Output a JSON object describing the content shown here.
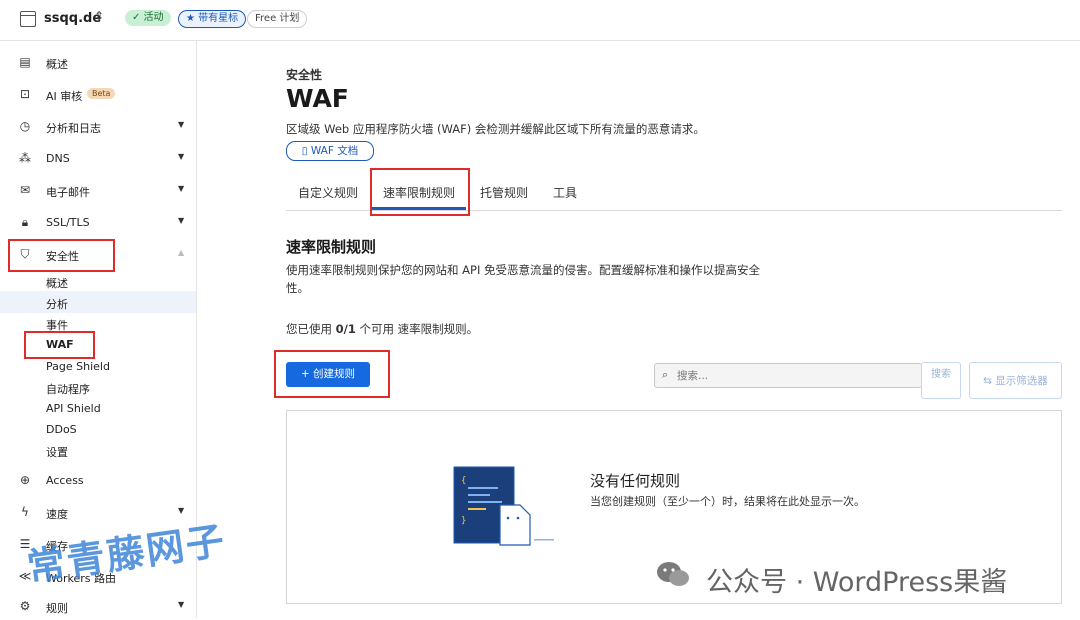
{
  "topbar": {
    "domain": "ssqq.de",
    "switch_icon": "chevron-up-down-icon",
    "badge_active": "✓ 活动",
    "badge_star": "★ 带有星标",
    "badge_plan": "Free 计划"
  },
  "sidebar": {
    "items": [
      {
        "label": "概述",
        "icon": "document-icon"
      },
      {
        "label": "AI 审核",
        "icon": "robot-icon",
        "badge": "Beta"
      },
      {
        "label": "分析和日志",
        "icon": "clock-chart-icon"
      },
      {
        "label": "DNS",
        "icon": "network-icon"
      },
      {
        "label": "电子邮件",
        "icon": "email-icon"
      },
      {
        "label": "SSL/TLS",
        "icon": "lock-icon"
      },
      {
        "label": "安全性",
        "icon": "shield-icon"
      }
    ],
    "security_sub": [
      "概述",
      "分析",
      "事件",
      "WAF",
      "Page Shield",
      "自动程序",
      "API Shield",
      "DDoS",
      "设置"
    ],
    "more_items": [
      {
        "label": "Access",
        "icon": "access-icon"
      },
      {
        "label": "速度",
        "icon": "lightning-icon"
      },
      {
        "label": "缓存",
        "icon": "cache-icon"
      },
      {
        "label": "Workers 路由",
        "icon": "workers-icon"
      },
      {
        "label": "规则",
        "icon": "rules-icon"
      }
    ]
  },
  "header": {
    "section": "安全性",
    "title": "WAF",
    "description": "区域级 Web 应用程序防火墙 (WAF) 会检测并缓解此区域下所有流量的恶意请求。",
    "doc_button": "WAF 文档"
  },
  "tabs": [
    "自定义规则",
    "速率限制规则",
    "托管规则",
    "工具"
  ],
  "rate_limit": {
    "title": "速率限制规则",
    "description": "使用速率限制规则保护您的网站和 API 免受恶意流量的侵害。配置缓解标准和操作以提高安全性。",
    "usage_prefix": "您已使用 ",
    "usage_value": "0/1",
    "usage_suffix": " 个可用 速率限制规则。",
    "create_button": "+ 创建规则",
    "search_placeholder": "搜索...",
    "search_button": "搜索",
    "filter_button": "⇆ 显示筛选器"
  },
  "empty_state": {
    "title": "没有任何规则",
    "description": "当您创建规则（至少一个）时，结果将在此处显示一次。"
  },
  "watermarks": {
    "left": "常青藤网子",
    "right": "公众号 · WordPress果酱"
  },
  "colors": {
    "accent": "#1769e0",
    "highlight": "#e02b2b"
  }
}
